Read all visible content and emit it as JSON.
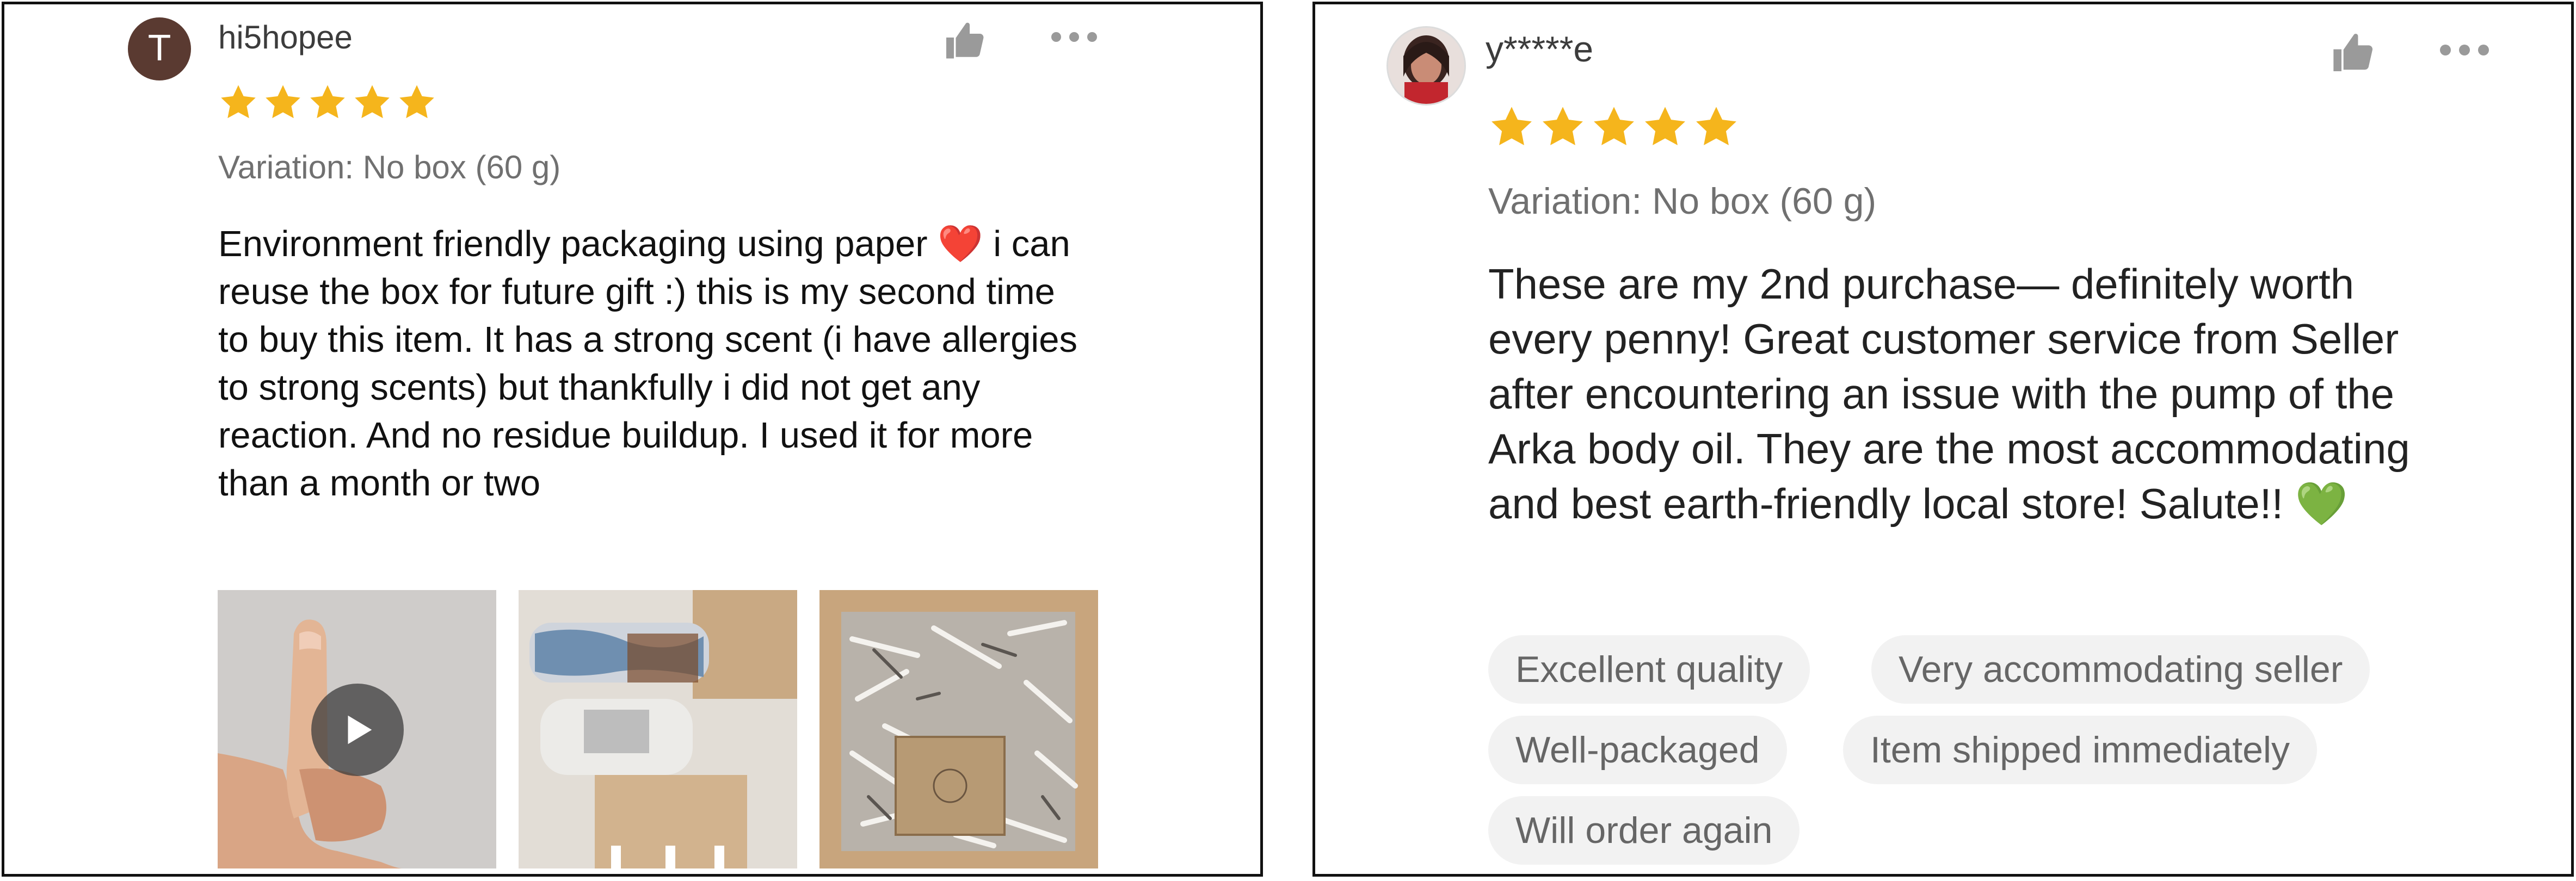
{
  "reviews": [
    {
      "avatar_letter": "T",
      "username": "hi5hopee",
      "rating": 5,
      "variation": "Variation: No box (60 g)",
      "text": "Environment friendly packaging using paper ❤️ i can reuse the  box for future gift :) this is my second time to buy this item. It has a strong scent (i have allergies to strong scents) but thankfully i did not get any reaction. And no residue buildup. I used it for more than a month or two",
      "icons": {
        "like": "thumbs-up-icon",
        "more": "more-dots-icon",
        "play": "play-icon",
        "star": "star-icon"
      }
    },
    {
      "username": "y*****e",
      "rating": 5,
      "variation": "Variation: No box (60 g)",
      "text": "These are my 2nd purchase— definitely worth every penny! Great customer service from Seller after encountering an issue with the pump of the Arka body oil. They are the most accommodating and best earth-friendly local store! Salute!! 💚",
      "tags": [
        "Excellent quality",
        "Very accommodating seller",
        "Well-packaged",
        "Item shipped immediately",
        "Will order again"
      ]
    }
  ],
  "colors": {
    "star": "#f5b51c",
    "avatar": "#5a3a31",
    "tag_bg": "#f2f2f2",
    "icon": "#9a9a9a"
  }
}
